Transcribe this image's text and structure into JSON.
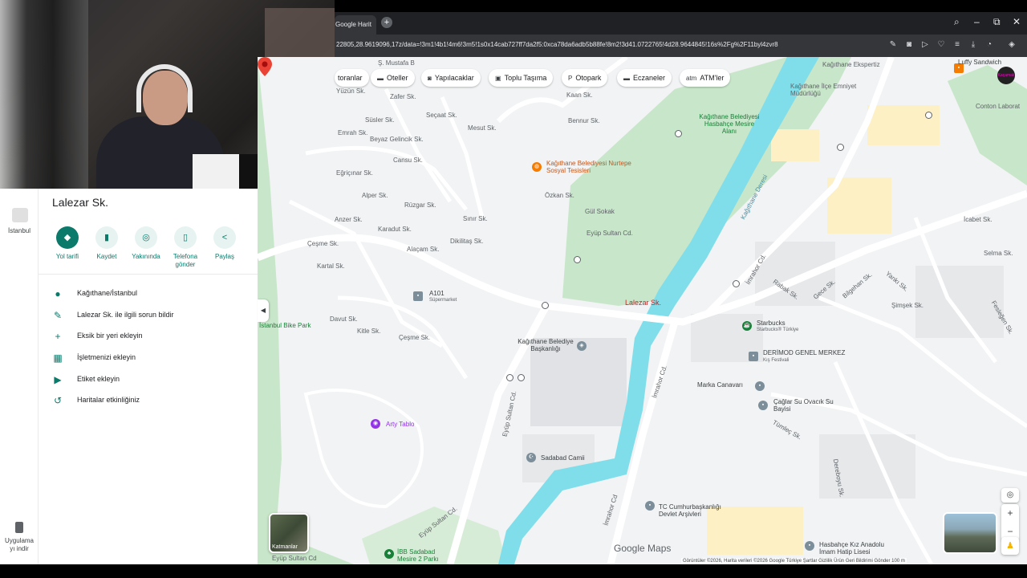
{
  "browser": {
    "tab_title": "Google Harit",
    "new_tab": "+",
    "url": "22805,28.9619096,17z/data=!3m1!4b1!4m6!3m5!1s0x14cab727ff7da2f5:0xca78da6adb5b88fe!8m2!3d41.0722765!4d28.9644845!16s%2Fg%2F11byl4zvr8",
    "controls": {
      "search": "⌕",
      "minimize": "–",
      "restore": "⧉",
      "close": "✕"
    }
  },
  "rail": {
    "recent_label": "İstanbul",
    "app_label_1": "Uygulama",
    "app_label_2": "yı indir"
  },
  "panel": {
    "title": "Lalezar Sk.",
    "actions": [
      {
        "label": "Yol tarifi",
        "icon": "◆"
      },
      {
        "label": "Kaydet",
        "icon": "▮"
      },
      {
        "label": "Yakınında",
        "icon": "◎"
      },
      {
        "label": "Telefona gönder",
        "icon": "▯"
      },
      {
        "label": "Paylaş",
        "icon": "<"
      }
    ],
    "info_rows": [
      {
        "icon": "●",
        "text": "Kağıthane/İstanbul"
      },
      {
        "icon": "✎",
        "text": "Lalezar Sk. ile ilgili sorun bildir"
      },
      {
        "icon": "+",
        "text": "Eksik bir yeri ekleyin"
      },
      {
        "icon": "▦",
        "text": "İşletmenizi ekleyin"
      },
      {
        "icon": "▶",
        "text": "Etiket ekleyin"
      },
      {
        "icon": "↺",
        "text": "Haritalar etkinliğiniz"
      }
    ],
    "collapse": "◀"
  },
  "map": {
    "chips": [
      {
        "label": "toranlar",
        "icon": ""
      },
      {
        "label": "Oteller",
        "icon": "▬"
      },
      {
        "label": "Yapılacaklar",
        "icon": "◙"
      },
      {
        "label": "Toplu Taşıma",
        "icon": "▣"
      },
      {
        "label": "Otopark",
        "icon": "P"
      },
      {
        "label": "Eczaneler",
        "icon": "▬"
      },
      {
        "label": "ATM'ler",
        "icon": "atm"
      }
    ],
    "selected_place": "Lalezar Sk.",
    "labels": {
      "mustafa": "Ş. Mustafa B",
      "yuzun": "Yüzün Sk.",
      "zafer": "Zafer Sk.",
      "susler": "Süsler Sk.",
      "secaat": "Seçaat Sk.",
      "mesut": "Mesut Sk.",
      "kaan": "Kaan Sk.",
      "bennur": "Bennur Sk.",
      "beyaz": "Beyaz Gelincik Sk.",
      "emrah": "Emrah Sk.",
      "cansu": "Cansu Sk.",
      "egriciinar": "Eğriçınar Sk.",
      "alper": "Alper Sk.",
      "anzer": "Anzer Sk.",
      "ruzgar": "Rüzgar Sk.",
      "simir": "Sınır Sk.",
      "dikilitas": "Dikilitaş Sk.",
      "ozkan": "Özkan Sk.",
      "gul": "Gül Sokak",
      "eyup1": "Eyüp Sultan Cd.",
      "karadut": "Karadut Sk.",
      "alacam": "Alaçam Sk.",
      "cesme": "Çeşme Sk.",
      "kartal": "Kartal Sk.",
      "davut": "Davut Sk.",
      "kitle": "Kitle Sk.",
      "cesme2": "Çeşme Sk.",
      "a101": "A101",
      "a101sub": "Süpermarket",
      "bikepark": "İstanbul Bike Park",
      "belediye_sosyal": "Kağıthane Belediyesi Nurtepe Sosyal Tesisleri",
      "belediye_mesire": "Kağıthane Belediyesi Hasbahçe Mesire Alanı",
      "deresi": "Kağıthane Deresi",
      "imrahor": "İmrahor Cd.",
      "baskanlik": "Kağıthane Belediye Başkanlığı",
      "arty": "Arty Tablo",
      "eyup2": "Eyüp Sultan Cd.",
      "sadabad": "Sadabad Camii",
      "eyup3": "Eyüp Sultan Cd.",
      "ibb": "İBB Sadabad Mesire 2 Parkı",
      "eyup4": "Eyüp Sultan Cd",
      "imrahor2": "İmrahor Cd.",
      "imrahor3": "İmrahor Cd",
      "cumhur": "TC Cumhurbaşkanlığı Devlet Arşivleri",
      "starbucks": "Starbucks",
      "starbucks_sub": "Starbucks® Türkiye",
      "derimod": "DERİMOD GENEL MERKEZ",
      "derimod_sub": "Kış Festivali",
      "marka": "Marka Canavarı",
      "caglar": "Çağlar Su Ovacık Su Bayisi",
      "luffy": "Luffy Sandwich",
      "ekspertiz": "Kağıthane Ekspertiz",
      "emniyet": "Kağıthane İlçe Emniyet Müdürlüğü",
      "laborat": "Conton Laborat",
      "rabak": "Rabak Sk.",
      "gece": "Gece Sk.",
      "bilgehan": "Bilgehan Sk.",
      "yanki": "Yankı Sk.",
      "simsek": "Şimşek Sk.",
      "feslegen": "Fesleğen Sk.",
      "tumlec": "Tümleç Sk.",
      "dereboyu": "Dereboyu Sk.",
      "hasbahce": "Hasbahçe Kız Anadolu İmam Hatip Lisesi",
      "selma": "Selma Sk.",
      "icabet": "İcabet Sk."
    },
    "layers_label": "Katmanlar",
    "google_maps": "Google Maps",
    "attribution": "Görüntüler ©2026, Harita verileri ©2026 Google   Türkiye   Şartlar   Gizlilik   Ürün Geri Bildirimi Gönder   100 m",
    "zoom_in": "+",
    "zoom_out": "−",
    "locate": "◎",
    "pegman": "♟",
    "avatar_text": "Kaçamak",
    "colors": {
      "water": "#80deea",
      "park": "#c8e6c9",
      "road": "#ffffff",
      "pin": "#ea4335",
      "accent": "#0b7a6b"
    }
  }
}
